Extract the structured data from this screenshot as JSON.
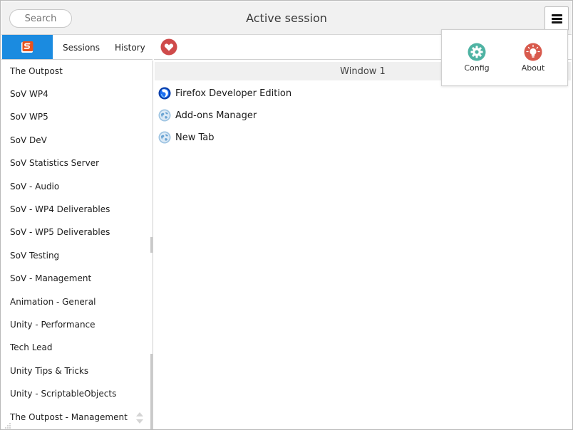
{
  "header": {
    "search_placeholder": "Search",
    "title": "Active session"
  },
  "tabs": {
    "sessions_label": "Sessions",
    "history_label": "History"
  },
  "sessions": [
    "The Outpost",
    "SoV WP4",
    "SoV WP5",
    "SoV DeV",
    "SoV Statistics Server",
    "SoV - Audio",
    "SoV - WP4 Deliverables",
    "SoV - WP5 Deliverables",
    "SoV Testing",
    "SoV - Management",
    "Animation - General",
    "Unity - Performance",
    "Tech Lead",
    "Unity Tips & Tricks",
    "Unity - ScriptableObjects",
    "The Outpost - Management"
  ],
  "main": {
    "window_label": "Window 1",
    "tabs": [
      {
        "title": "Firefox Developer Edition",
        "icon": "firefox-developer-icon"
      },
      {
        "title": "Add-ons Manager",
        "icon": "globe-icon"
      },
      {
        "title": "New Tab",
        "icon": "globe-icon"
      }
    ]
  },
  "menu": {
    "config_label": "Config",
    "about_label": "About",
    "config_icon": "gear-icon",
    "about_icon": "lightbulb-icon"
  },
  "colors": {
    "accent_blue": "#1b8be0",
    "logo_orange": "#e8521c",
    "favorite_red": "#cf4b4b",
    "config_teal": "#4fb3a3",
    "about_red": "#d85a4d"
  }
}
